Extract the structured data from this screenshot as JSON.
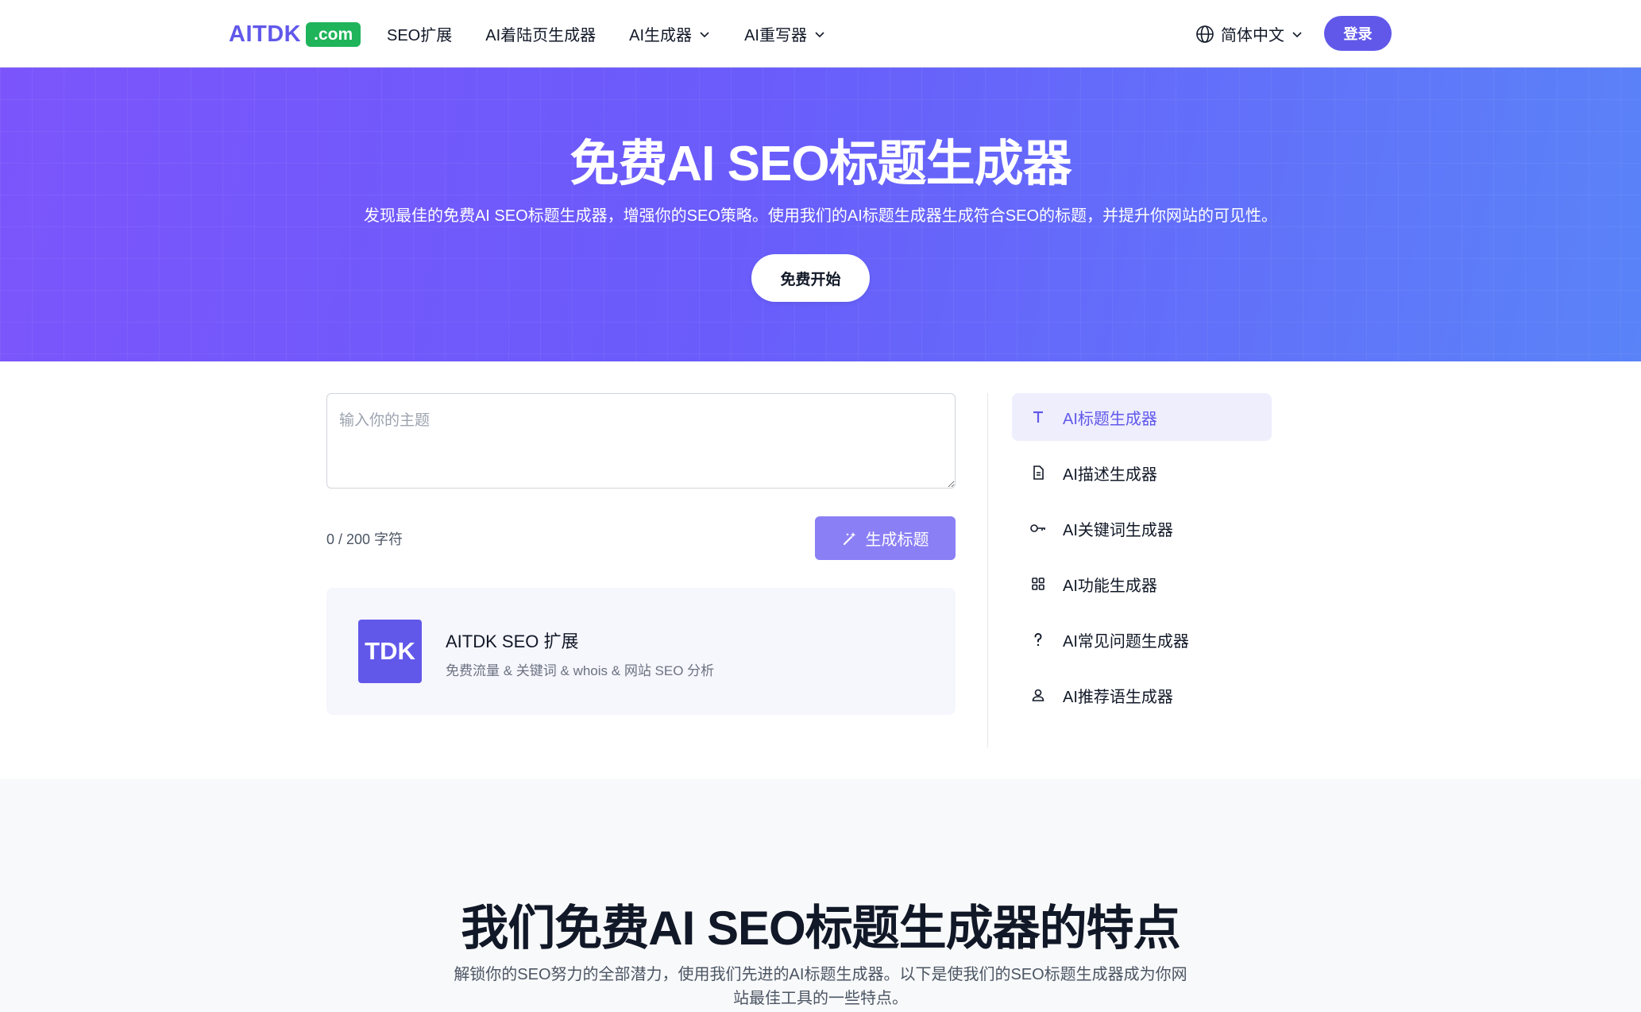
{
  "header": {
    "logo_text": "AITDK",
    "logo_badge": ".com",
    "nav": [
      {
        "label": "SEO扩展"
      },
      {
        "label": "AI着陆页生成器"
      },
      {
        "label": "AI生成器"
      },
      {
        "label": "AI重写器"
      }
    ],
    "language": "简体中文",
    "login": "登录"
  },
  "hero": {
    "title": "免费AI SEO标题生成器",
    "subtitle": "发现最佳的免费AI SEO标题生成器，增强你的SEO策略。使用我们的AI标题生成器生成符合SEO的标题，并提升你网站的可见性。",
    "cta": "免费开始"
  },
  "form": {
    "placeholder": "输入你的主题",
    "char_count": "0 / 200 字符",
    "generate": "生成标题"
  },
  "extension": {
    "logo": "TDK",
    "title": "AITDK SEO 扩展",
    "desc": "免费流量 & 关键词 & whois & 网站 SEO 分析"
  },
  "sidebar": [
    {
      "label": "AI标题生成器",
      "icon": "text-t-icon"
    },
    {
      "label": "AI描述生成器",
      "icon": "document-icon"
    },
    {
      "label": "AI关键词生成器",
      "icon": "key-icon"
    },
    {
      "label": "AI功能生成器",
      "icon": "grid-icon"
    },
    {
      "label": "AI常见问题生成器",
      "icon": "question-icon"
    },
    {
      "label": "AI推荐语生成器",
      "icon": "user-icon"
    }
  ],
  "features": {
    "title": "我们免费AI SEO标题生成器的特点",
    "subtitle": "解锁你的SEO努力的全部潜力，使用我们先进的AI标题生成器。以下是使我们的SEO标题生成器成为你网站最佳工具的一些特点。"
  },
  "colors": {
    "accent": "#6158ea",
    "badge_green": "#1fb45a",
    "hero_start": "#7b55fb",
    "hero_end": "#5a83f8"
  }
}
